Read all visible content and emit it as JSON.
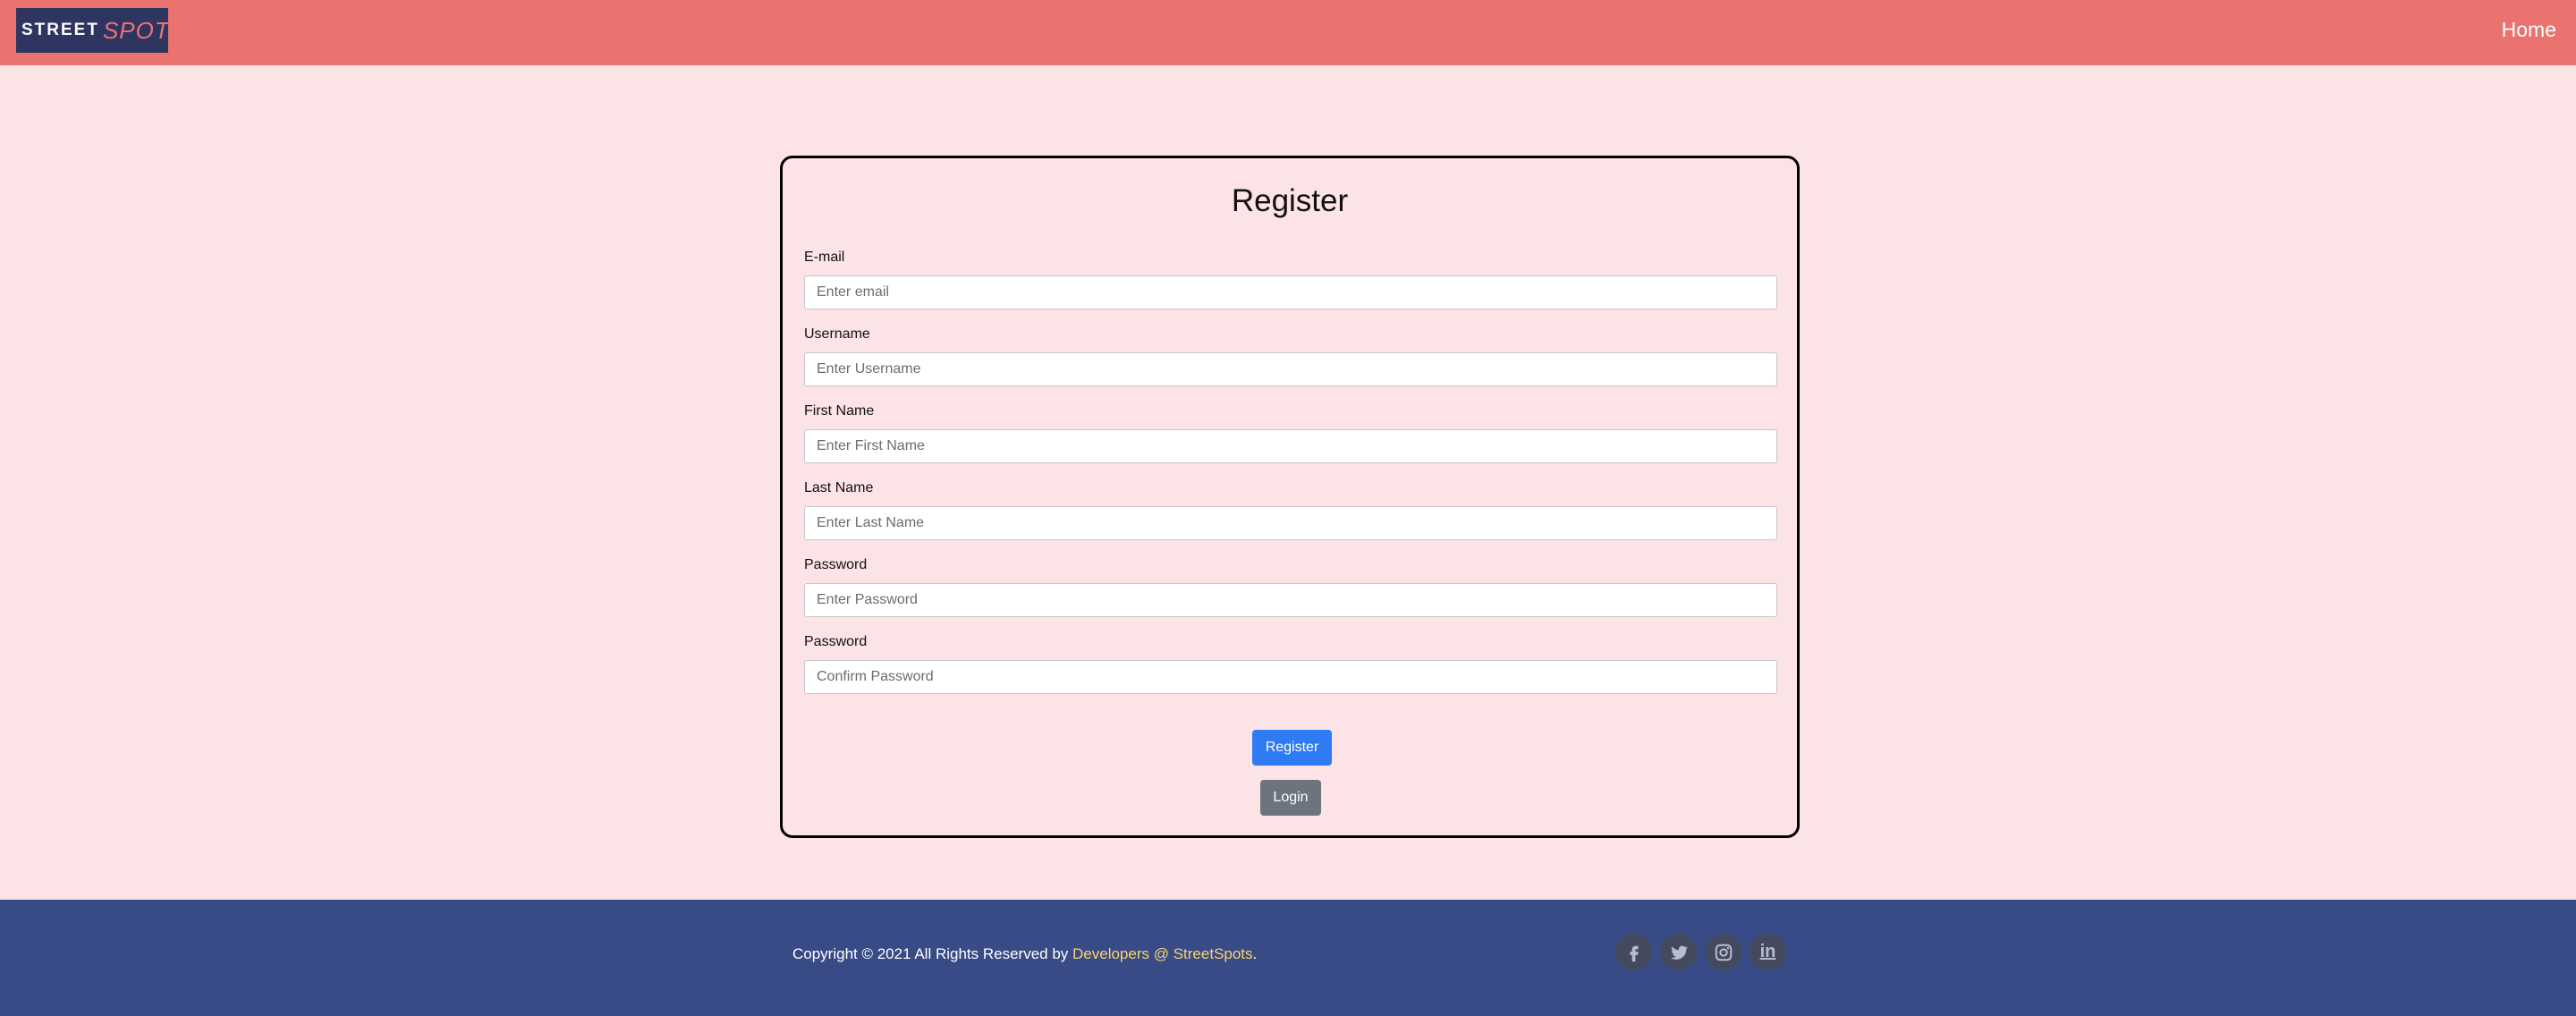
{
  "header": {
    "logo_street": "STREET",
    "logo_spots": "SPOTS",
    "home_link": "Home"
  },
  "form": {
    "title": "Register",
    "fields": [
      {
        "label": "E-mail",
        "placeholder": "Enter email"
      },
      {
        "label": "Username",
        "placeholder": "Enter Username"
      },
      {
        "label": "First Name",
        "placeholder": "Enter First Name"
      },
      {
        "label": "Last Name",
        "placeholder": "Enter Last Name"
      },
      {
        "label": "Password",
        "placeholder": "Enter Password"
      },
      {
        "label": "Password",
        "placeholder": "Confirm Password"
      }
    ],
    "register_button": "Register",
    "login_button": "Login"
  },
  "footer": {
    "copyright_prefix": "Copyright © 2021 All Rights Reserved by ",
    "developers_link": "Developers @ StreetSpots",
    "copyright_suffix": ".",
    "social_icons": [
      "facebook-icon",
      "twitter-icon",
      "instagram-icon",
      "linkedin-icon"
    ],
    "linkedin_text": "in"
  },
  "colors": {
    "navbar": "#ea736f",
    "background": "#fce3e5",
    "footer": "#394b86",
    "primary_button": "#2f7bf3",
    "secondary_button": "#6c757d",
    "link_accent": "#f6d46a"
  }
}
